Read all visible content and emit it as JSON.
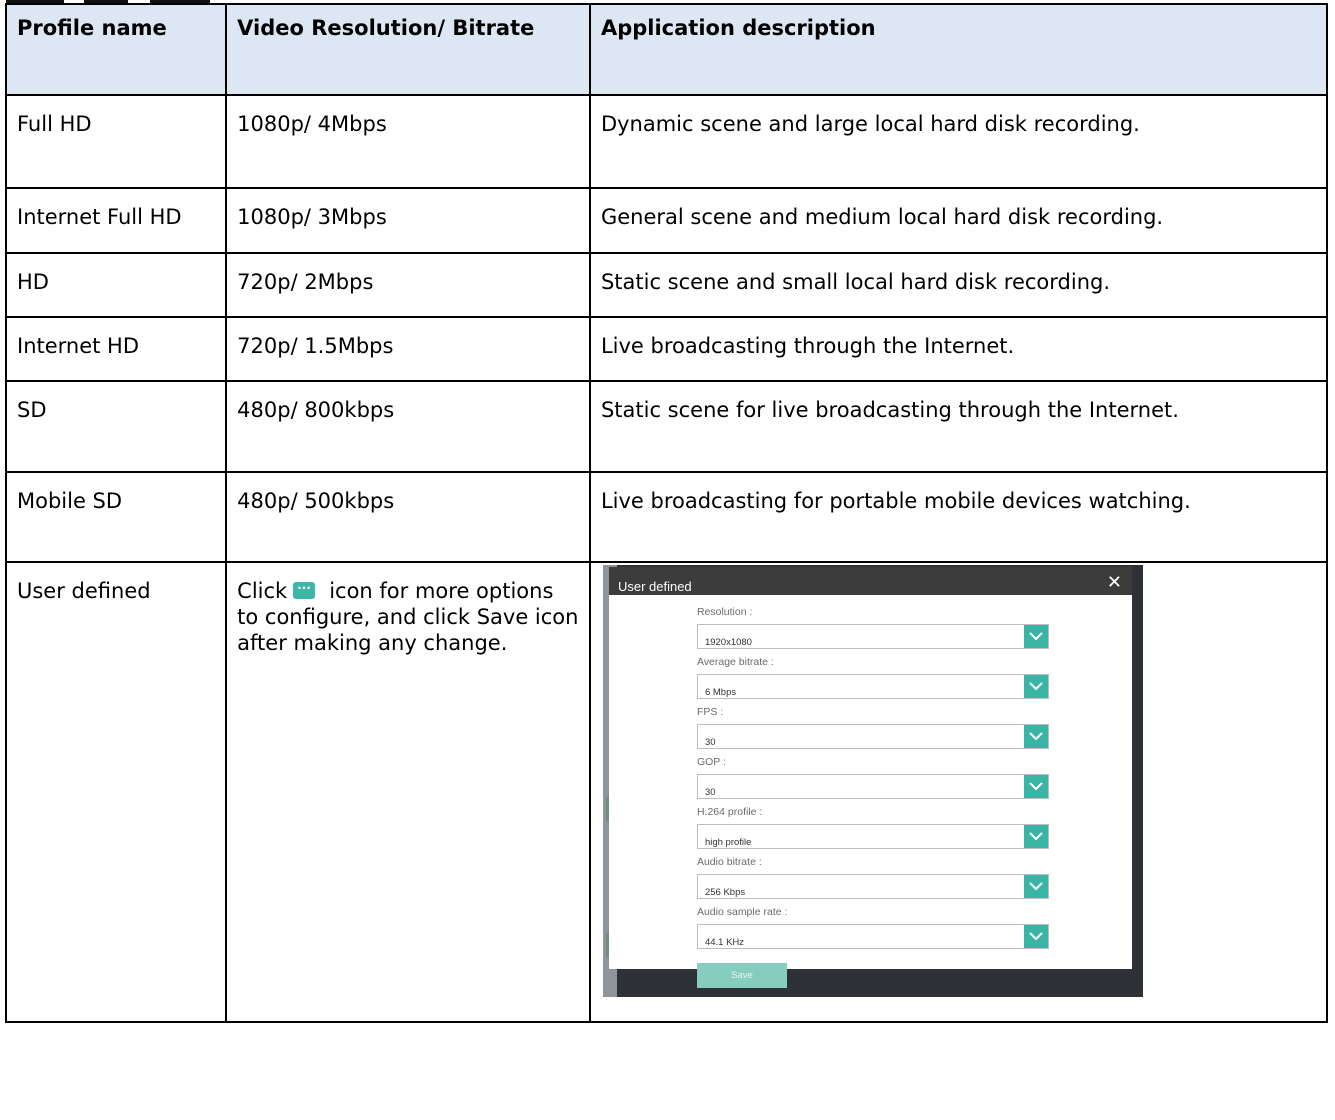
{
  "table": {
    "headers": [
      "Profile name",
      "Video Resolution/ Bitrate",
      "Application description"
    ],
    "rows": [
      {
        "name": "Full HD",
        "resolution": "1080p/ 4Mbps",
        "description": "Dynamic scene and large local hard disk recording."
      },
      {
        "name": "Internet Full HD",
        "resolution": "1080p/ 3Mbps",
        "description": "General scene and medium local hard disk recording."
      },
      {
        "name": "HD",
        "resolution": "720p/ 2Mbps",
        "description": "Static scene and small local hard disk recording."
      },
      {
        "name": "Internet HD",
        "resolution": "720p/ 1.5Mbps",
        "description": "Live broadcasting through the Internet."
      },
      {
        "name": "SD",
        "resolution": "480p/ 800kbps",
        "description": "Static scene for live broadcasting through the Internet."
      },
      {
        "name": "Mobile SD",
        "resolution": "480p/ 500kbps",
        "description": "Live broadcasting for portable mobile devices watching."
      }
    ],
    "user_defined": {
      "name": "User defined",
      "instruction_before_icon": "Click",
      "instruction_after_icon": "icon for more options to configure, and click Save icon after making any change.",
      "icon": "more-options-icon"
    }
  },
  "dialog": {
    "title": "User defined",
    "close_icon": "close-icon",
    "fields": [
      {
        "label": "Resolution :",
        "value": "1920x1080"
      },
      {
        "label": "Average bitrate :",
        "value": "6 Mbps"
      },
      {
        "label": "FPS :",
        "value": "30"
      },
      {
        "label": "GOP :",
        "value": "30"
      },
      {
        "label": "H.264 profile :",
        "value": "high profile"
      },
      {
        "label": "Audio bitrate :",
        "value": "256 Kbps"
      },
      {
        "label": "Audio sample rate :",
        "value": "44.1 KHz"
      }
    ],
    "save_label": "Save",
    "accent_color": "#3ab4a4"
  }
}
